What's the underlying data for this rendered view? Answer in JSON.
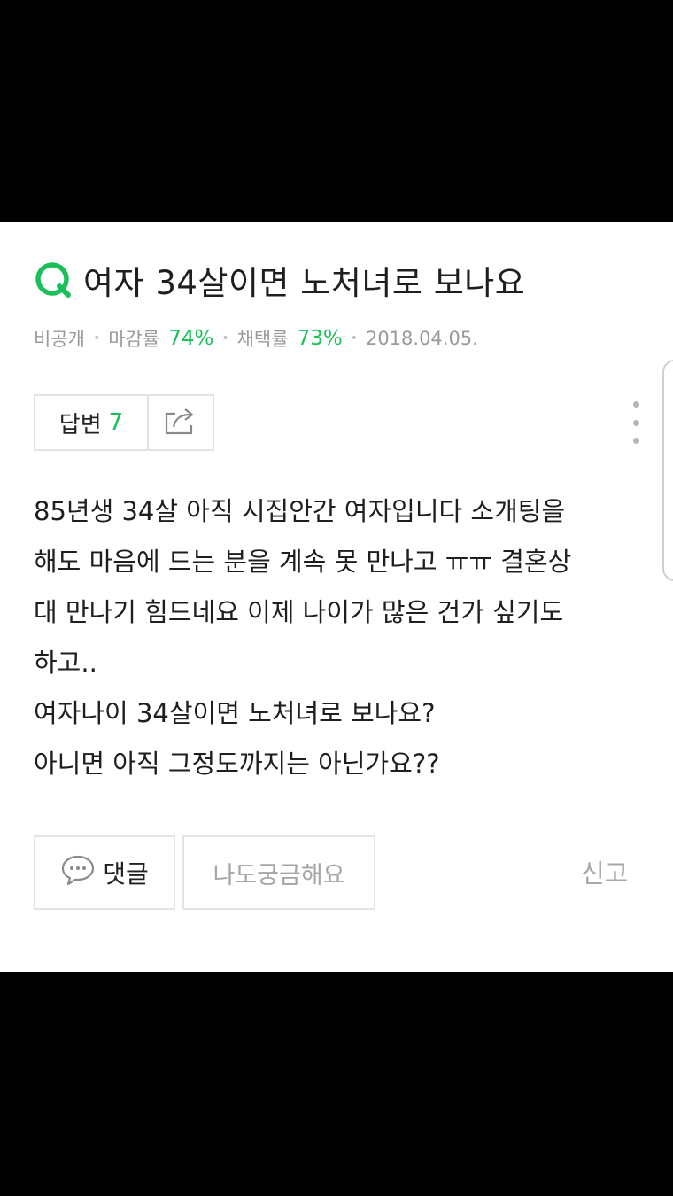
{
  "question": {
    "title": "여자 34살이면 노처녀로 보나요",
    "meta": {
      "visibility": "비공개",
      "deadline_label": "마감률",
      "deadline_rate": "74%",
      "adoption_label": "채택률",
      "adoption_rate": "73%",
      "date": "2018.04.05."
    },
    "answer_label": "답변",
    "answer_count": "7",
    "body_lines": [
      "85년생 34살 아직 시집안간 여자입니다 소개팅을",
      "해도 마음에 드는 분을 계속 못 만나고 ㅠㅠ 결혼상",
      "대 만나기 힘드네요 이제 나이가 많은 건가 싶기도",
      "하고..",
      "여자나이 34살이면 노처녀로 보나요?",
      "아니면 아직 그정도까지는 아닌가요??"
    ]
  },
  "actions": {
    "comment_label": "댓글",
    "curious_label": "나도궁금해요",
    "report_label": "신고"
  },
  "colors": {
    "accent": "#19c05a",
    "text": "#1e1e1e",
    "muted": "#9a9a9a",
    "border": "#e2e2e2"
  },
  "icons": {
    "question": "q-icon",
    "share": "share-icon",
    "more": "more-vertical-icon",
    "comment": "speech-bubble-icon"
  }
}
